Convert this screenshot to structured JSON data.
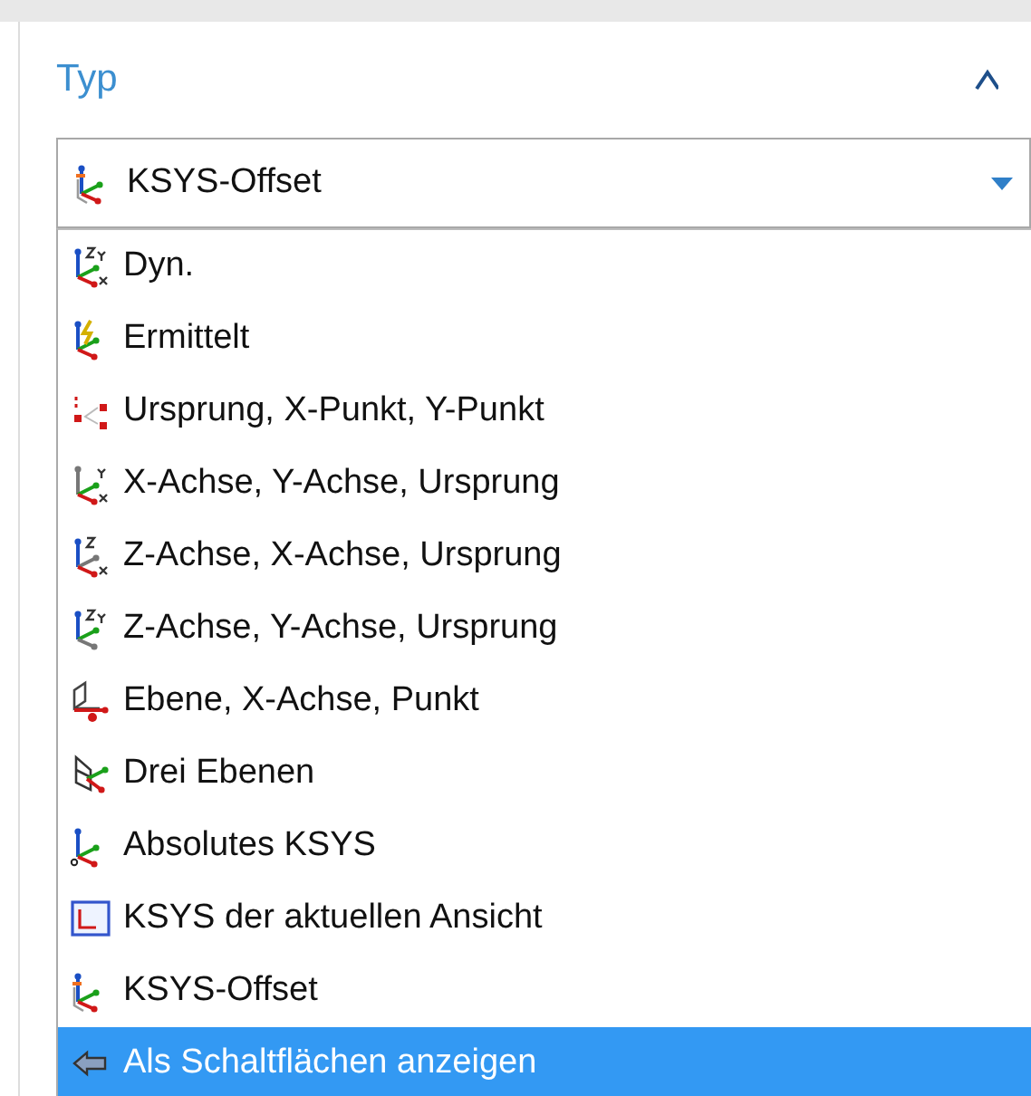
{
  "section": {
    "title": "Typ",
    "expanded": true
  },
  "dropdown": {
    "value": "KSYS-Offset",
    "open": true
  },
  "options": [
    {
      "label": "Dyn.",
      "selected": false
    },
    {
      "label": "Ermittelt",
      "selected": false
    },
    {
      "label": "Ursprung, X-Punkt, Y-Punkt",
      "selected": false
    },
    {
      "label": "X-Achse, Y-Achse, Ursprung",
      "selected": false
    },
    {
      "label": "Z-Achse, X-Achse, Ursprung",
      "selected": false
    },
    {
      "label": "Z-Achse, Y-Achse, Ursprung",
      "selected": false
    },
    {
      "label": "Ebene, X-Achse, Punkt",
      "selected": false
    },
    {
      "label": "Drei Ebenen",
      "selected": false
    },
    {
      "label": "Absolutes KSYS",
      "selected": false
    },
    {
      "label": "KSYS der aktuellen Ansicht",
      "selected": false
    },
    {
      "label": "KSYS-Offset",
      "selected": false
    },
    {
      "label": "Als Schaltflächen anzeigen",
      "selected": true
    }
  ]
}
